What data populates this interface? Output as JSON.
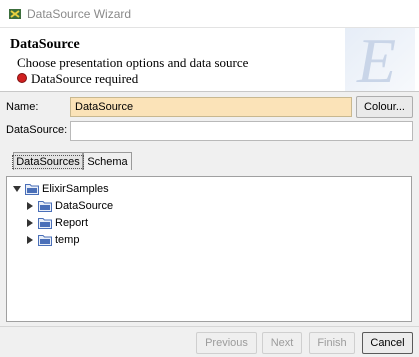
{
  "window": {
    "title": "DataSource Wizard"
  },
  "header": {
    "title": "DataSource",
    "subtitle": "Choose presentation options and data source",
    "error": "DataSource required"
  },
  "form": {
    "name_label": "Name:",
    "name_value": "DataSource",
    "colour_button": "Colour...",
    "datasource_label": "DataSource:",
    "datasource_value": ""
  },
  "tabs": [
    {
      "label": "DataSources",
      "active": true
    },
    {
      "label": "Schema",
      "active": false
    }
  ],
  "tree": {
    "root": {
      "label": "ElixirSamples",
      "expanded": true
    },
    "children": [
      {
        "label": "DataSource",
        "expanded": false
      },
      {
        "label": "Report",
        "expanded": false
      },
      {
        "label": "temp",
        "expanded": false
      }
    ]
  },
  "buttons": {
    "previous": "Previous",
    "next": "Next",
    "finish": "Finish",
    "cancel": "Cancel"
  },
  "colors": {
    "name_field_bg": "#fbe3b8",
    "error_dot": "#d02020",
    "folder_blue": "#4a6fb8"
  }
}
